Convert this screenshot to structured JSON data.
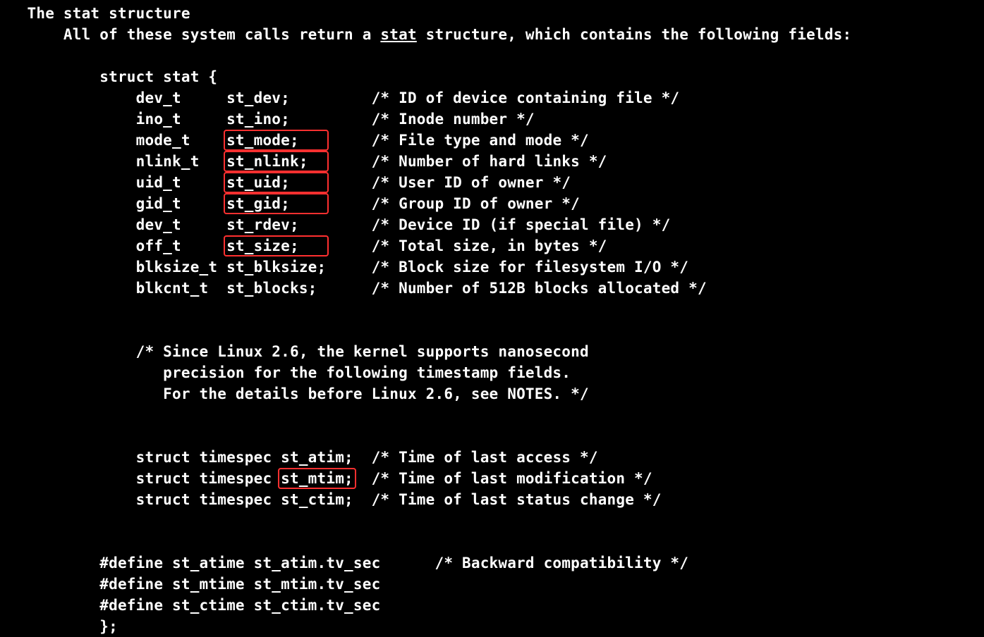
{
  "header": {
    "title_indent": "   ",
    "title": "The stat structure",
    "intro_indent": "       ",
    "intro_prefix": "All of these system calls return a ",
    "intro_underlined": "stat",
    "intro_suffix": " structure, which contains the following fields:"
  },
  "struct": {
    "open_indent": "           ",
    "open": "struct stat {",
    "field_indent": "               ",
    "fields": [
      {
        "type": "dev_t     ",
        "name": "st_dev;    ",
        "gap": "     ",
        "comment": "/* ID of device containing file */",
        "boxed": false
      },
      {
        "type": "ino_t     ",
        "name": "st_ino;    ",
        "gap": "     ",
        "comment": "/* Inode number */",
        "boxed": false
      },
      {
        "type": "mode_t    ",
        "name": "st_mode;   ",
        "gap": "     ",
        "comment": "/* File type and mode */",
        "boxed": true
      },
      {
        "type": "nlink_t   ",
        "name": "st_nlink;  ",
        "gap": "     ",
        "comment": "/* Number of hard links */",
        "boxed": true
      },
      {
        "type": "uid_t     ",
        "name": "st_uid;    ",
        "gap": "     ",
        "comment": "/* User ID of owner */",
        "boxed": true
      },
      {
        "type": "gid_t     ",
        "name": "st_gid;    ",
        "gap": "     ",
        "comment": "/* Group ID of owner */",
        "boxed": true
      },
      {
        "type": "dev_t     ",
        "name": "st_rdev;   ",
        "gap": "     ",
        "comment": "/* Device ID (if special file) */",
        "boxed": false
      },
      {
        "type": "off_t     ",
        "name": "st_size;   ",
        "gap": "     ",
        "comment": "/* Total size, in bytes */",
        "boxed": true
      },
      {
        "type": "blksize_t ",
        "name": "st_blksize;",
        "gap": "     ",
        "comment": "/* Block size for filesystem I/O */",
        "boxed": false
      },
      {
        "type": "blkcnt_t  ",
        "name": "st_blocks; ",
        "gap": "     ",
        "comment": "/* Number of 512B blocks allocated */",
        "boxed": false
      }
    ],
    "note": [
      "/* Since Linux 2.6, the kernel supports nanosecond",
      "   precision for the following timestamp fields.",
      "   For the details before Linux 2.6, see NOTES. */"
    ],
    "timespecs": [
      {
        "prefix": "struct timespec ",
        "name": "st_atim;",
        "gap": "  ",
        "comment": "/* Time of last access */",
        "boxed": false
      },
      {
        "prefix": "struct timespec ",
        "name": "st_mtim;",
        "gap": "  ",
        "comment": "/* Time of last modification */",
        "boxed": true
      },
      {
        "prefix": "struct timespec ",
        "name": "st_ctim;",
        "gap": "  ",
        "comment": "/* Time of last status change */",
        "boxed": false
      }
    ],
    "defines_indent": "           ",
    "defines": [
      {
        "text": "#define st_atime st_atim.tv_sec      /* Backward compatibility */"
      },
      {
        "text": "#define st_mtime st_mtim.tv_sec"
      },
      {
        "text": "#define st_ctime st_ctim.tv_sec"
      }
    ],
    "close": "};"
  },
  "highlight_color": "#ff3030"
}
